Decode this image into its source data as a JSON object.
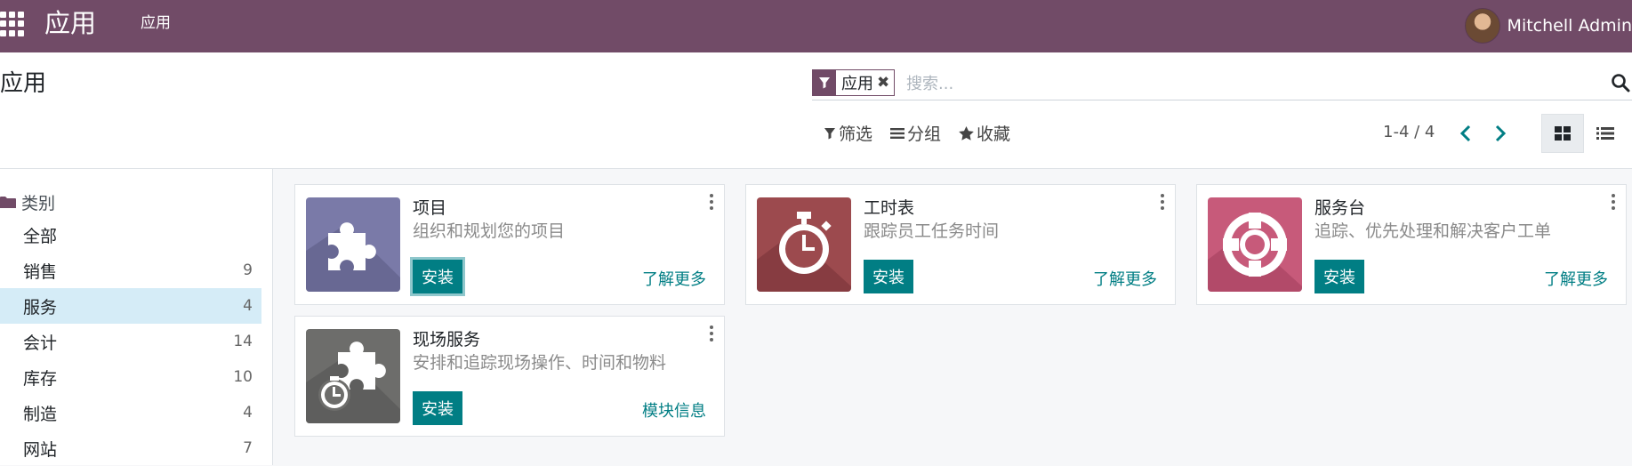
{
  "navbar": {
    "brand": "应用",
    "menu_item": "应用",
    "user_name": "Mitchell Admin"
  },
  "control": {
    "title": "应用",
    "facet_label": "应用",
    "search_placeholder": "搜索...",
    "filters_label": "筛选",
    "group_label": "分组",
    "favorites_label": "收藏",
    "pager": "1-4 / 4"
  },
  "sidebar": {
    "header": "类别",
    "items": [
      {
        "label": "全部",
        "count": ""
      },
      {
        "label": "销售",
        "count": "9"
      },
      {
        "label": "服务",
        "count": "4"
      },
      {
        "label": "会计",
        "count": "14"
      },
      {
        "label": "库存",
        "count": "10"
      },
      {
        "label": "制造",
        "count": "4"
      },
      {
        "label": "网站",
        "count": "7"
      }
    ]
  },
  "cards": [
    {
      "title": "项目",
      "desc": "组织和规划您的项目",
      "install": "安装",
      "link": "了解更多"
    },
    {
      "title": "工时表",
      "desc": "跟踪员工任务时间",
      "install": "安装",
      "link": "了解更多"
    },
    {
      "title": "服务台",
      "desc": "追踪、优先处理和解决客户工单",
      "install": "安装",
      "link": "了解更多"
    },
    {
      "title": "现场服务",
      "desc": "安排和追踪现场操作、时间和物料",
      "install": "安装",
      "link": "模块信息"
    }
  ],
  "colors": {
    "brand": "#714b67",
    "accent": "#017e84",
    "project_icon": "#7a7aa8",
    "timesheet_icon": "#9c4a4e",
    "helpdesk_icon": "#c75a7a",
    "fieldservice_icon": "#6d6d6b"
  },
  "icons": {
    "project": "puzzle-icon",
    "timesheet": "stopwatch-icon",
    "helpdesk": "lifebuoy-icon",
    "fieldservice": "puzzle-clock-icon"
  }
}
